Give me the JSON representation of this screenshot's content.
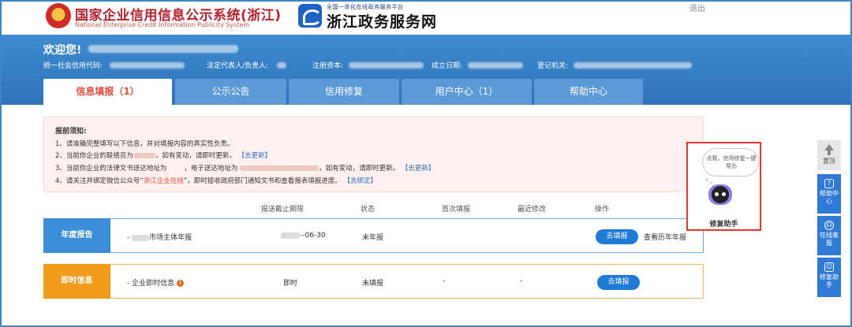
{
  "header": {
    "system_title": "国家企业信用信息公示系统(浙江)",
    "system_subtitle": "National Enterprise Credit Information Publicity System",
    "portal_small": "全国一体化在线政务服务平台",
    "portal_title": "浙江政务服务网",
    "logout_label": "退出"
  },
  "user_band": {
    "welcome": "欢迎您!",
    "fields": [
      {
        "label": "统一社会信用代码:"
      },
      {
        "label": "法定代表人/负责人:"
      },
      {
        "label": "注册资本:"
      },
      {
        "label": "成立日期:"
      },
      {
        "label": "登记机关:"
      }
    ]
  },
  "tabs": [
    {
      "label": "信息填报（1）",
      "active": true
    },
    {
      "label": "公示公告",
      "active": false
    },
    {
      "label": "信用修复",
      "active": false
    },
    {
      "label": "用户中心（1）",
      "active": false
    },
    {
      "label": "帮助中心",
      "active": false
    }
  ],
  "notice": {
    "title": "报前须知:",
    "line1": "1、请准确完整填写以下信息，并对填报内容的真实性负责。",
    "line2_a": "2、当前你企业的联络员为",
    "line2_b": "，如有变动，请即时更新。",
    "line2_link": "【去更新】",
    "line3_a": "3、当前你企业的法律文书送达地址为",
    "line3_b": "，电子送达地址为",
    "line3_c": "，如有变动，请即时更新。",
    "line3_link": "【去更新】",
    "line4_a": "4、请关注并绑定微信公众号“",
    "line4_red": "浙江企业在线",
    "line4_b": "”，即时接收政府部门通知文书和查看报表填报进度。",
    "line4_link": "【去绑定】"
  },
  "table": {
    "headers": [
      "报送截止期限",
      "状态",
      "首次填报",
      "最近修改",
      "操作"
    ],
    "rows": [
      {
        "category": "年度报告",
        "item": "市场主体年报",
        "item_prefix": "- ",
        "deadline": "--06-30",
        "status": "未年报",
        "first": "",
        "last": "",
        "action": "去填报",
        "extra_link": "查看历年年报"
      },
      {
        "category": "即时信息",
        "item": "企业即时信息",
        "item_prefix": "- ",
        "warn_icon": "!",
        "deadline": "即时",
        "status": "未填报",
        "first": "-",
        "last": "-",
        "action": "去填报"
      }
    ]
  },
  "assistant": {
    "bubble": "点我，信用修复一键帮办",
    "label": "修复助手"
  },
  "rail": {
    "top": "置顶",
    "items": [
      "帮助中心",
      "在线客服",
      "修复助手"
    ]
  },
  "colors": {
    "brand_blue": "#2f73bb",
    "accent_red": "#e74c3c",
    "orange": "#f29b1d",
    "button_blue": "#1f7ad6"
  }
}
